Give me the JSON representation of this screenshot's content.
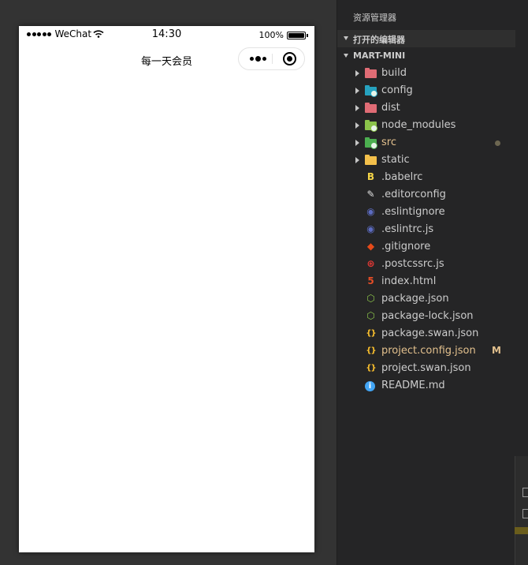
{
  "simulator": {
    "statusbar": {
      "carrier": "WeChat",
      "time": "14:30",
      "battery_percent": "100%",
      "battery_level": 1.0,
      "signal_icon": "signal-dots-icon",
      "wifi_icon": "wifi-icon"
    },
    "navbar": {
      "title": "每一天会员",
      "capsule_more_icon": "more-dots-icon",
      "capsule_close_icon": "target-circle-icon"
    }
  },
  "explorer": {
    "title": "资源管理器",
    "open_editors_label": "打开的编辑器",
    "project_label": "MART-MINI",
    "items": [
      {
        "name": "build",
        "type": "folder",
        "icon": "folder-icon",
        "color": "#e06c75"
      },
      {
        "name": "config",
        "type": "folder",
        "icon": "folder-config-icon",
        "color": "#26a2bf"
      },
      {
        "name": "dist",
        "type": "folder",
        "icon": "folder-icon",
        "color": "#e06c75"
      },
      {
        "name": "node_modules",
        "type": "folder",
        "icon": "folder-node-icon",
        "color": "#8bc34a"
      },
      {
        "name": "src",
        "type": "folder",
        "icon": "folder-src-icon",
        "color": "#4caf50",
        "status": "dot"
      },
      {
        "name": "static",
        "type": "folder",
        "icon": "folder-icon",
        "color": "#f4c04b"
      },
      {
        "name": ".babelrc",
        "type": "file",
        "icon": "babel-icon",
        "color": "#f5d547"
      },
      {
        "name": ".editorconfig",
        "type": "file",
        "icon": "editorconfig-icon",
        "color": "#e0e0e0"
      },
      {
        "name": ".eslintignore",
        "type": "file",
        "icon": "eslint-icon",
        "color": "#5c6bc0"
      },
      {
        "name": ".eslintrc.js",
        "type": "file",
        "icon": "eslint-icon",
        "color": "#5c6bc0"
      },
      {
        "name": ".gitignore",
        "type": "file",
        "icon": "git-icon",
        "color": "#e64a19"
      },
      {
        "name": ".postcssrc.js",
        "type": "file",
        "icon": "postcss-icon",
        "color": "#e53935"
      },
      {
        "name": "index.html",
        "type": "file",
        "icon": "html-icon",
        "color": "#e44d26"
      },
      {
        "name": "package.json",
        "type": "file",
        "icon": "nodejs-icon",
        "color": "#8bc34a"
      },
      {
        "name": "package-lock.json",
        "type": "file",
        "icon": "nodejs-icon",
        "color": "#8bc34a"
      },
      {
        "name": "package.swan.json",
        "type": "file",
        "icon": "json-icon",
        "color": "#fbc02d"
      },
      {
        "name": "project.config.json",
        "type": "file",
        "icon": "json-icon",
        "color": "#fbc02d",
        "status": "M"
      },
      {
        "name": "project.swan.json",
        "type": "file",
        "icon": "json-icon",
        "color": "#fbc02d"
      },
      {
        "name": "README.md",
        "type": "file",
        "icon": "info-icon",
        "color": "#42a5f5"
      }
    ]
  }
}
